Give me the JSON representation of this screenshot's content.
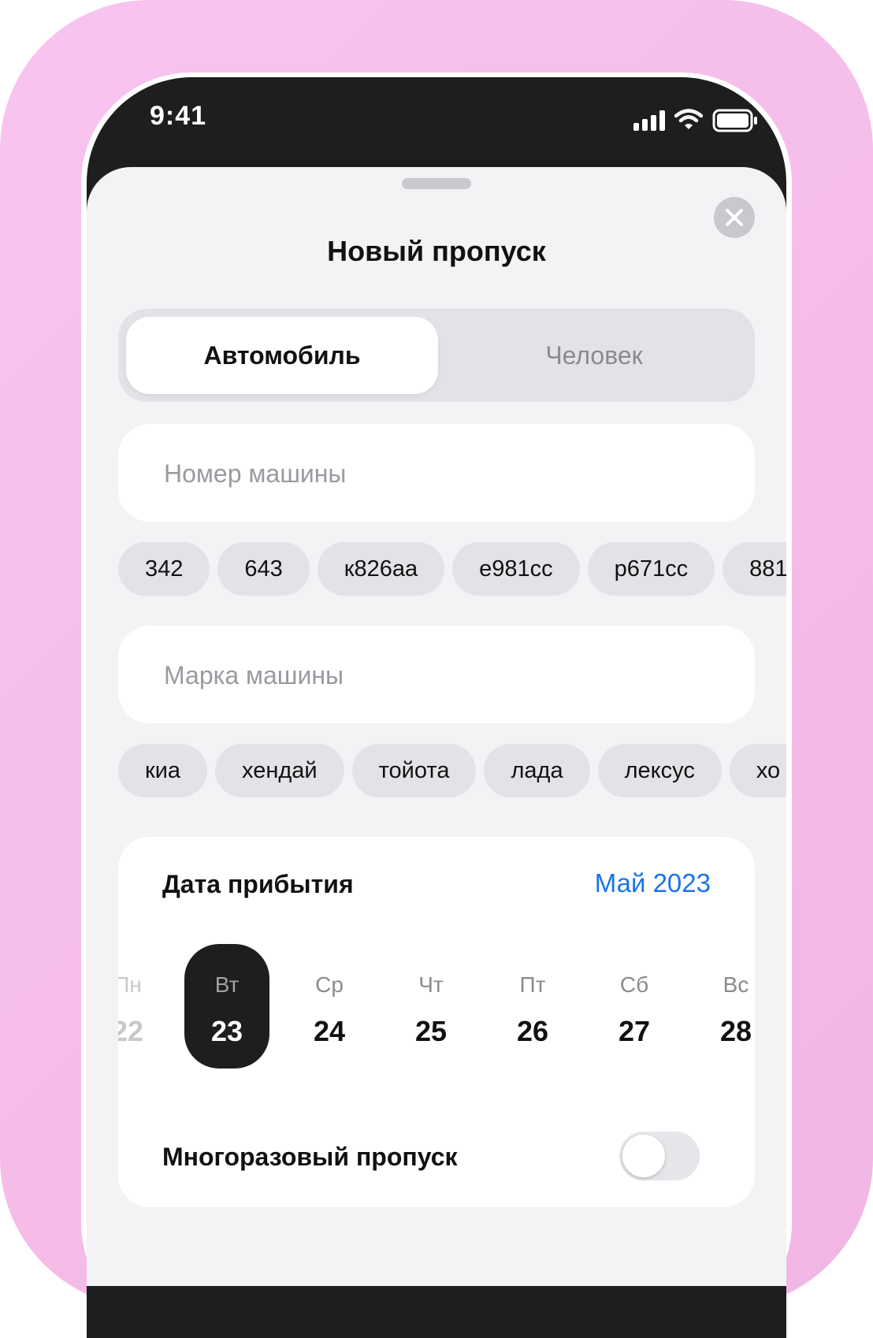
{
  "status_bar": {
    "time": "9:41",
    "icons": [
      "signal-icon",
      "wifi-icon",
      "battery-icon"
    ]
  },
  "sheet": {
    "title": "Новый пропуск",
    "close_icon": "close-icon"
  },
  "segmented": {
    "active": "Автомобиль",
    "inactive": "Человек"
  },
  "car_number": {
    "placeholder": "Номер машины",
    "value": "",
    "suggestions": [
      "342",
      "643",
      "к826аа",
      "е981сс",
      "р671сс",
      "881"
    ]
  },
  "car_brand": {
    "placeholder": "Марка машины",
    "value": "",
    "suggestions": [
      "киа",
      "хендай",
      "тойота",
      "лада",
      "лексус",
      "хо"
    ]
  },
  "arrival": {
    "label": "Дата прибытия",
    "month": "Май 2023",
    "days": [
      {
        "dow": "Пн",
        "num": "22"
      },
      {
        "dow": "Вт",
        "num": "23"
      },
      {
        "dow": "Ср",
        "num": "24"
      },
      {
        "dow": "Чт",
        "num": "25"
      },
      {
        "dow": "Пт",
        "num": "26"
      },
      {
        "dow": "Сб",
        "num": "27"
      },
      {
        "dow": "Вс",
        "num": "28"
      }
    ],
    "selected_index": 1
  },
  "multi_pass": {
    "label": "Многоразовый пропуск",
    "enabled": false
  },
  "colors": {
    "accent": "#1a73e8",
    "selected_day_bg": "#1e1e1e",
    "frame_pink": "#f6bde9"
  }
}
